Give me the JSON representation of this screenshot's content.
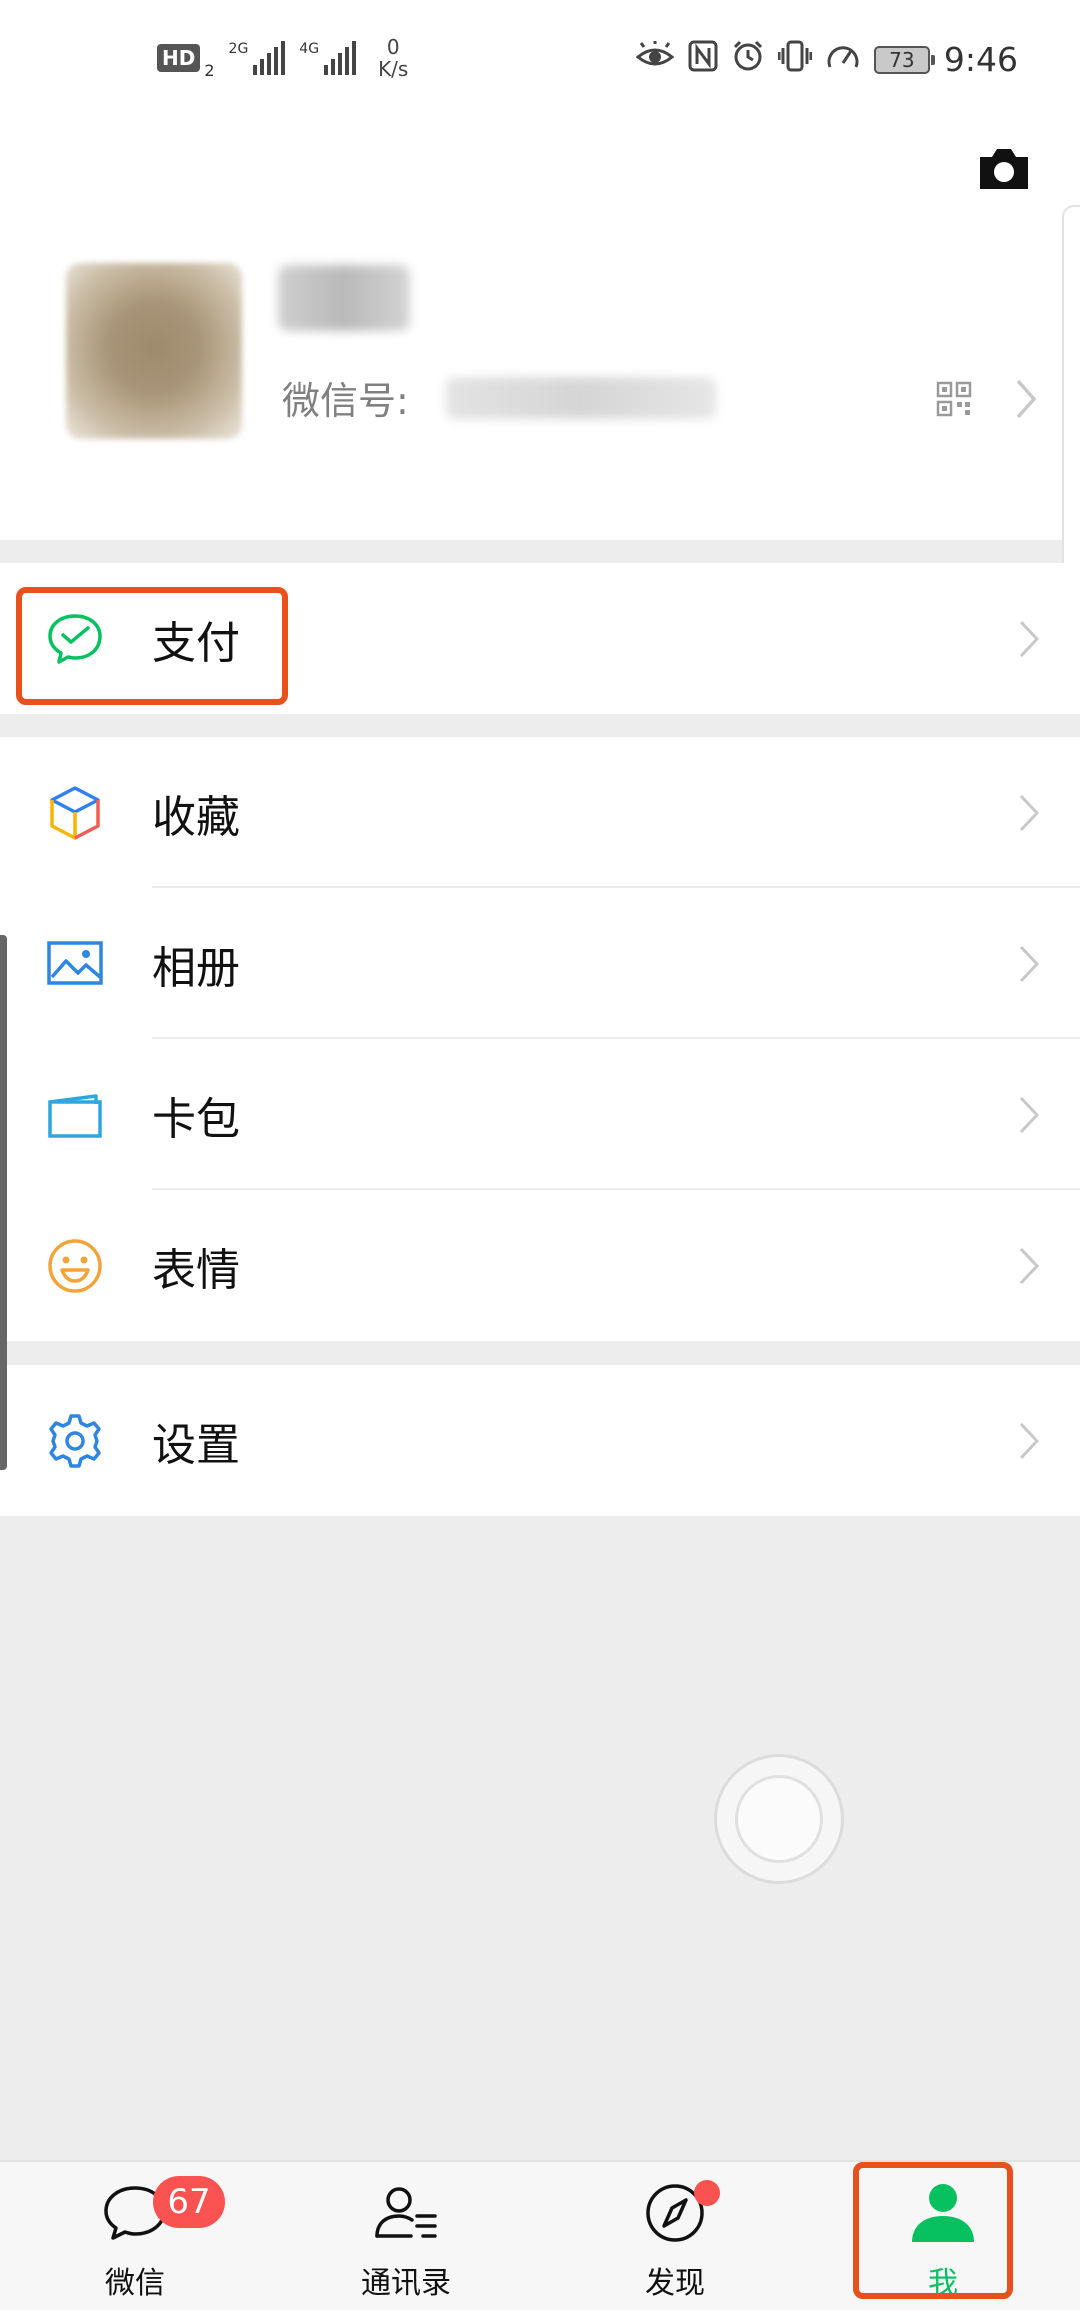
{
  "status_bar": {
    "hd_label": "HD",
    "hd_sub": "2",
    "signal1_label": "2G",
    "signal2_label": "4G",
    "speed_value": "0",
    "speed_unit": "K/s",
    "battery": "73",
    "time": "9:46"
  },
  "profile": {
    "wechat_id_label": "微信号:"
  },
  "menu": {
    "pay": "支付",
    "favorites": "收藏",
    "album": "相册",
    "cards": "卡包",
    "stickers": "表情",
    "settings": "设置"
  },
  "tabs": {
    "chats": "微信",
    "chats_badge": "67",
    "contacts": "通讯录",
    "discover": "发现",
    "me": "我"
  },
  "colors": {
    "brand_green": "#07c160",
    "highlight": "#e8501c",
    "badge_red": "#fa5151"
  }
}
